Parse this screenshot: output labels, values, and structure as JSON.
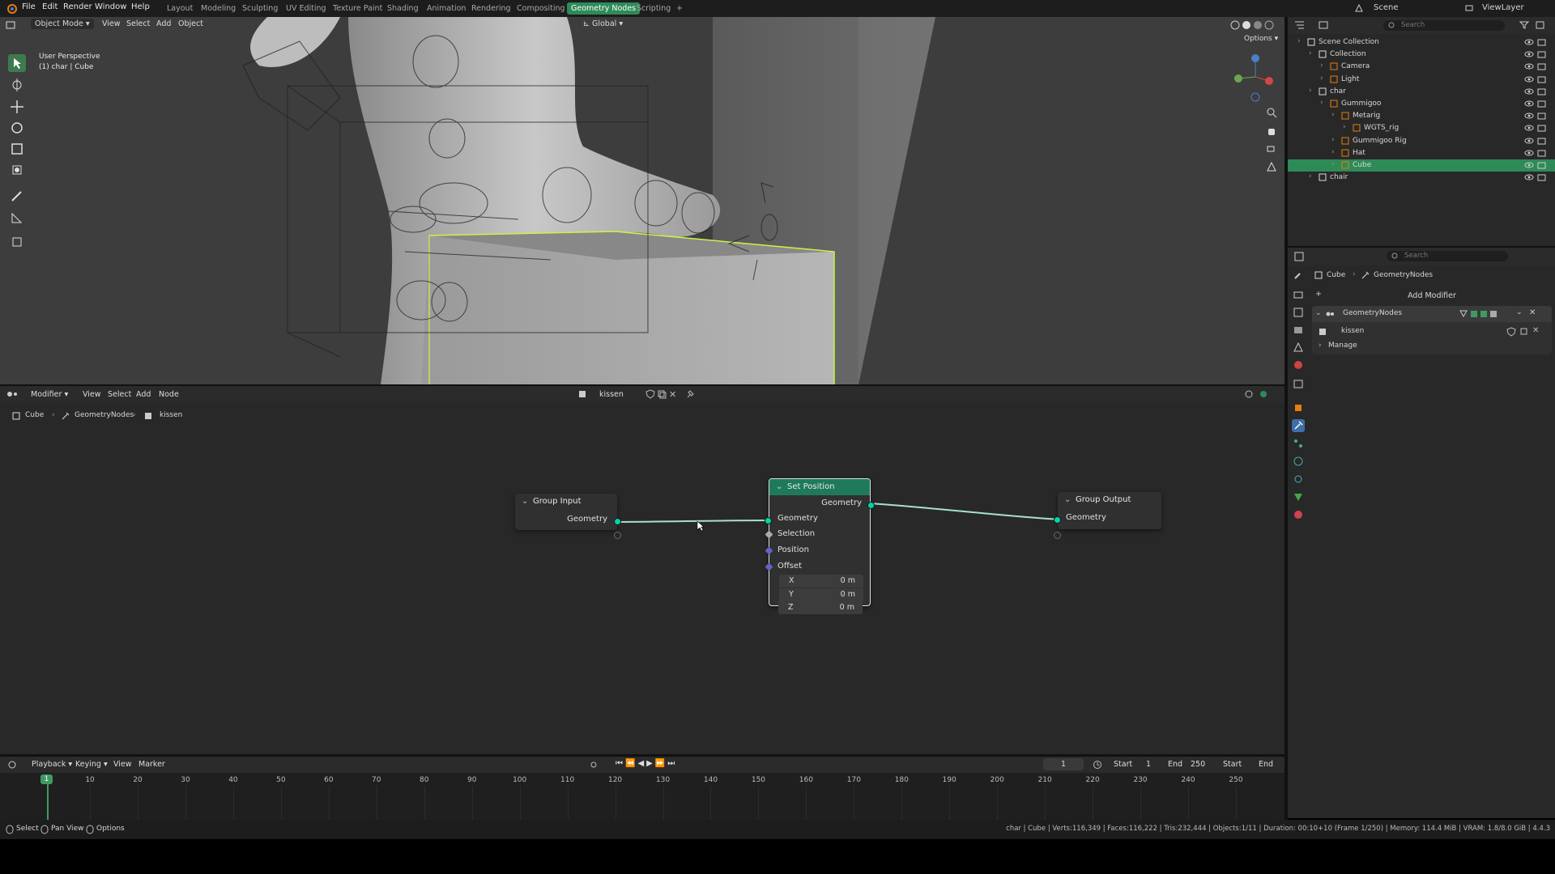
{
  "topbar": {
    "menus": [
      "File",
      "Edit",
      "Render",
      "Window",
      "Help"
    ],
    "workspaces": [
      "Layout",
      "Modeling",
      "Sculpting",
      "UV Editing",
      "Texture Paint",
      "Shading",
      "Animation",
      "Rendering",
      "Compositing",
      "Geometry Nodes",
      "Scripting"
    ],
    "active_workspace": "Geometry Nodes",
    "add_tab": "+",
    "scene": "Scene",
    "view_layer": "ViewLayer"
  },
  "viewport": {
    "mode": "Object Mode",
    "menus": [
      "View",
      "Select",
      "Add",
      "Object"
    ],
    "transform_orientation": "Global",
    "overlay_title": "User Perspective",
    "overlay_subtitle": "(1) char | Cube",
    "options": "Options"
  },
  "node_editor": {
    "editor_type": "Modifier",
    "menus": [
      "View",
      "Select",
      "Add",
      "Node"
    ],
    "node_group": "kissen",
    "breadcrumb": [
      "Cube",
      "GeometryNodes",
      "kissen"
    ],
    "nodes": {
      "group_input": {
        "title": "Group Input",
        "output": "Geometry"
      },
      "set_position": {
        "title": "Set Position",
        "output": "Geometry",
        "inputs": [
          "Geometry",
          "Selection",
          "Position",
          "Offset"
        ],
        "offset": [
          {
            "axis": "X",
            "value": "0 m"
          },
          {
            "axis": "Y",
            "value": "0 m"
          },
          {
            "axis": "Z",
            "value": "0 m"
          }
        ]
      },
      "group_output": {
        "title": "Group Output",
        "input": "Geometry"
      }
    },
    "colors": {
      "geometry_socket": "#00d6a3",
      "set_position_header": "#1f7a5c",
      "vector_socket": "#6363c7"
    }
  },
  "timeline": {
    "menus": [
      "Playback",
      "Keying",
      "View",
      "Marker"
    ],
    "current_frame": "1",
    "start_label": "Start",
    "start": "1",
    "end_label": "End",
    "end": "250",
    "right_start": "Start",
    "right_end": "End",
    "ticks": [
      "1",
      "10",
      "20",
      "30",
      "40",
      "50",
      "60",
      "70",
      "80",
      "90",
      "100",
      "110",
      "120",
      "130",
      "140",
      "150",
      "160",
      "170",
      "180",
      "190",
      "200",
      "210",
      "220",
      "230",
      "240",
      "250"
    ]
  },
  "statusbar": {
    "left": [
      "Select",
      "Pan View",
      "Options"
    ],
    "right": "char | Cube | Verts:116,349 | Faces:116,222 | Tris:232,444 | Objects:1/11 | Duration: 00:10+10 (Frame 1/250) | Memory: 114.4 MiB | VRAM: 1.8/8.0 GiB | 4.4.3"
  },
  "outliner": {
    "search_placeholder": "Search",
    "rows": [
      {
        "label": "Scene Collection",
        "indent": 0
      },
      {
        "label": "Collection",
        "indent": 1
      },
      {
        "label": "Camera",
        "indent": 2
      },
      {
        "label": "Light",
        "indent": 2
      },
      {
        "label": "char",
        "indent": 1
      },
      {
        "label": "Gummigoo",
        "indent": 2
      },
      {
        "label": "Metarig",
        "indent": 3
      },
      {
        "label": "WGTS_rig",
        "indent": 4
      },
      {
        "label": "Gummigoo Rig",
        "indent": 3
      },
      {
        "label": "Hat",
        "indent": 3
      },
      {
        "label": "Cube",
        "indent": 3,
        "selected": true
      },
      {
        "label": "chair",
        "indent": 1
      }
    ]
  },
  "properties": {
    "search_placeholder": "Search",
    "breadcrumb": [
      "Cube",
      "GeometryNodes"
    ],
    "add_modifier": "Add Modifier",
    "modifier_name": "GeometryNodes",
    "node_group": "kissen",
    "manage": "Manage"
  }
}
